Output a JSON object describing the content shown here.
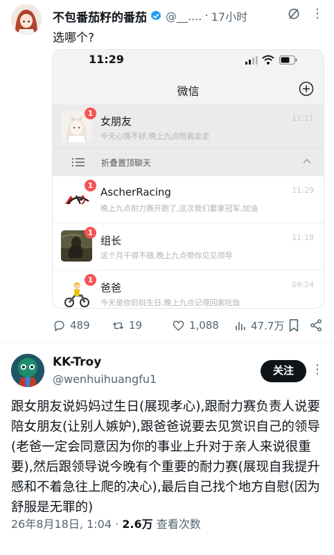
{
  "tweet1": {
    "author_name": "不包番茄籽的番茄",
    "handle": "@__....",
    "time": "17小时",
    "text": "选哪个?",
    "icons": {
      "verified": "verified-badge-icon",
      "grok": "grok-icon",
      "more": "more-icon"
    },
    "colors": {
      "verified": "#1d9bf0"
    },
    "metrics": {
      "replies": "489",
      "retweets": "19",
      "likes": "1,088",
      "views": "47.7万"
    }
  },
  "screenshot": {
    "status_time": "11:29",
    "app_title": "微信",
    "folded_label": "折叠置顶聊天",
    "colors": {
      "badge": "#fa5151"
    },
    "chats": [
      {
        "name": "女朋友",
        "message": "今天心情不好,晚上九点陪我走走",
        "time": "11:11",
        "badge": "1"
      },
      {
        "name": "AscherRacing",
        "message": "晚上九点耐力赛开跑了,这次我们要拿冠军,加油",
        "time": "11:29",
        "badge": "1"
      },
      {
        "name": "组长",
        "message": "这个月干得不错,晚上九点带你见见领导",
        "time": "11:18",
        "badge": "1"
      },
      {
        "name": "爸爸",
        "message": "今天是你妈妈生日,晚上九点记得回家吃饭",
        "time": "09:24",
        "badge": "1"
      }
    ]
  },
  "tweet2": {
    "author_name": "KK-Troy",
    "handle": "@wenhuihuangfu1",
    "follow_label": "关注",
    "body": "跟女朋友说妈妈过生日(展现孝心),跟耐力赛负责人说要陪女朋友(让别人嫉妒),跟爸爸说要去见赏识自己的领导(老爸一定会同意因为你的事业上升对于亲人来说很重要),然后跟领导说今晚有个重要的耐力赛(展现自我提升感和不着急往上爬的决心),最后自己找个地方自慰(因为舒服是无罪的)",
    "date": "26年8月18日, 1:04",
    "separator": "·",
    "views_count": "2.6万",
    "views_label": "查看次数"
  }
}
